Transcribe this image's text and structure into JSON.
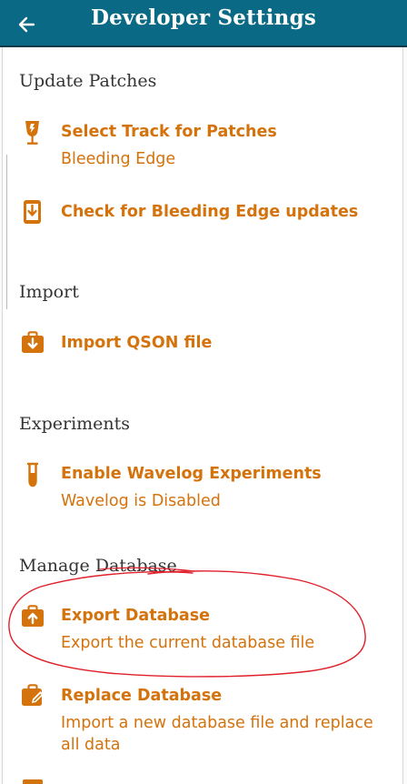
{
  "appbar": {
    "title": "Developer Settings",
    "back_icon": "arrow-left-icon"
  },
  "colors": {
    "appbar": "#0a6a85",
    "accent": "#d4720c",
    "annotation": "#e0202a"
  },
  "sections": [
    {
      "title": "Update Patches",
      "items": [
        {
          "title": "Select Track for Patches",
          "subtitle": "Bleeding Edge",
          "icon": "cup-icon"
        },
        {
          "title": "Check for Bleeding Edge updates",
          "subtitle": "",
          "icon": "phone-download-icon"
        }
      ]
    },
    {
      "title": "Import",
      "items": [
        {
          "title": "Import QSON file",
          "subtitle": "",
          "icon": "briefcase-download-icon"
        }
      ]
    },
    {
      "title": "Experiments",
      "items": [
        {
          "title": "Enable Wavelog Experiments",
          "subtitle": "Wavelog is Disabled",
          "icon": "test-tube-icon"
        }
      ]
    },
    {
      "title": "Manage Database",
      "items": [
        {
          "title": "Export Database",
          "subtitle": "Export the current database file",
          "icon": "briefcase-upload-icon"
        },
        {
          "title": "Replace Database",
          "subtitle": "Import a new database file and replace all data",
          "icon": "briefcase-edit-icon"
        }
      ]
    }
  ]
}
